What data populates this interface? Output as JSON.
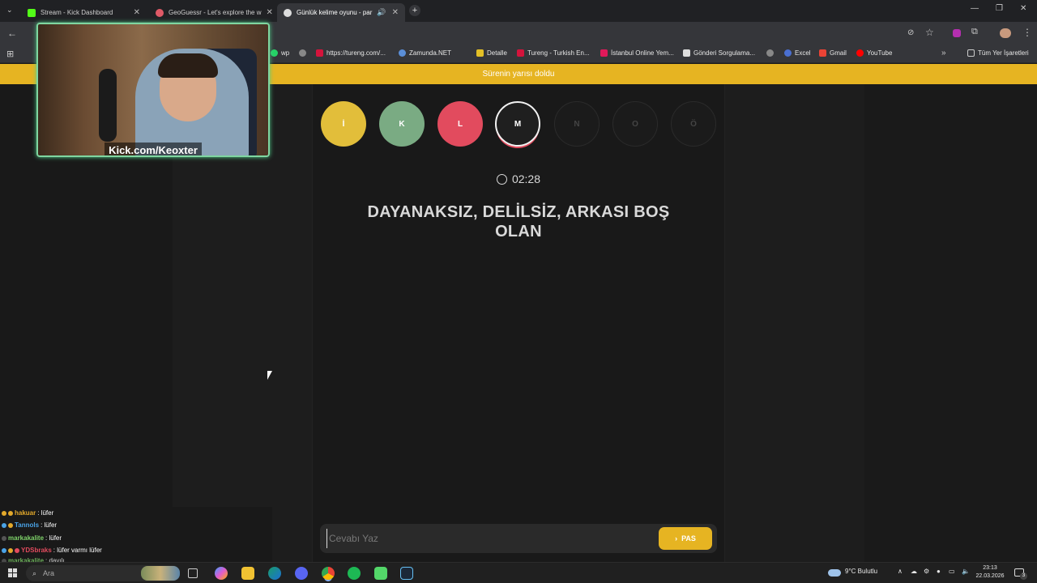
{
  "tabs": [
    {
      "title": "Stream - Kick Dashboard",
      "active": false
    },
    {
      "title": "GeoGuessr - Let's explore the w",
      "active": false
    },
    {
      "title": "Günlük kelime oyunu - par",
      "active": true
    }
  ],
  "bookmarks": [
    {
      "label": "wp"
    },
    {
      "label": "https://tureng.com/..."
    },
    {
      "label": "Zamunda.NET"
    },
    {
      "label": "Detalle"
    },
    {
      "label": "Tureng - Turkish En..."
    },
    {
      "label": "İstanbul Online Yem..."
    },
    {
      "label": "Gönderi Sorgulama..."
    },
    {
      "label": "Excel"
    },
    {
      "label": "Gmail"
    },
    {
      "label": "YouTube"
    },
    {
      "label": "Tüm Yer İşaretleri"
    }
  ],
  "banner": {
    "text": "Sürenin yarısı doldu"
  },
  "game": {
    "letters": [
      {
        "letter": "İ",
        "state": "present",
        "color": "#e2be3a"
      },
      {
        "letter": "K",
        "state": "correct",
        "color": "#7aab83"
      },
      {
        "letter": "L",
        "state": "wrong",
        "color": "#e24b5e"
      },
      {
        "letter": "M",
        "state": "current",
        "color": "#1f1f1f"
      },
      {
        "letter": "N",
        "state": "pending"
      },
      {
        "letter": "O",
        "state": "pending"
      },
      {
        "letter": "Ö",
        "state": "pending"
      }
    ],
    "timer": "02:28",
    "clue": "DAYANAKSIZ, DELİLSİZ, ARKASI BOŞ OLAN",
    "answer_placeholder": "Cevabı Yaz",
    "answer_value": "",
    "pass_label": "PAS"
  },
  "webcam": {
    "label": "Kick.com/Keoxter"
  },
  "chat": [
    {
      "user": "hakuar",
      "message": ": lüfer",
      "user_color": "#e3a92b"
    },
    {
      "user": "Tannols",
      "message": ": lüfer",
      "user_color": "#4aa3e6"
    },
    {
      "user": "markakalite",
      "message": ": lüfer",
      "user_color": "#7fd36a"
    },
    {
      "user": "YDSbraks",
      "message": ": lüfer varmı lüfer",
      "user_color": "#e24b5e"
    },
    {
      "user": "markakalite",
      "message": ": dayılı",
      "user_color": "#7fd36a"
    }
  ],
  "taskbar": {
    "search_placeholder": "Ara",
    "weather": "9°C  Bulutlu",
    "time": "23:13",
    "date": "22.03.2026",
    "notification_count": "3"
  },
  "colors": {
    "accent": "#e6b422",
    "background": "#1c1c1c"
  }
}
